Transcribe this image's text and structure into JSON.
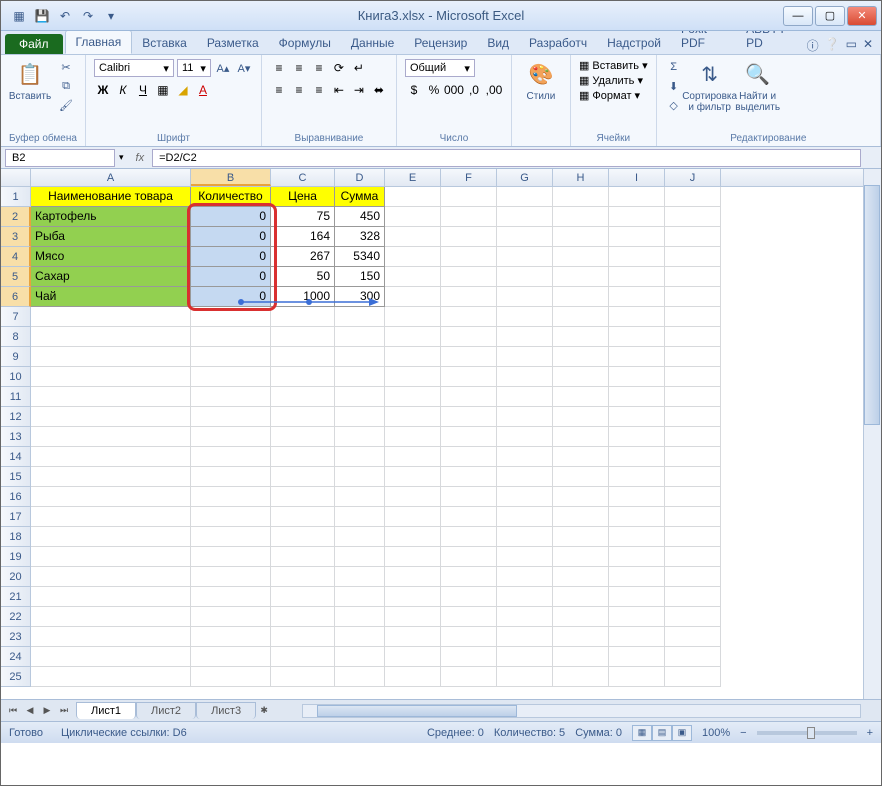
{
  "title": "Книга3.xlsx  -  Microsoft Excel",
  "qat": {
    "save": "💾",
    "undo": "↶",
    "redo": "↷"
  },
  "tabs": {
    "file": "Файл",
    "items": [
      "Главная",
      "Вставка",
      "Разметка",
      "Формулы",
      "Данные",
      "Рецензир",
      "Вид",
      "Разработч",
      "Надстрой",
      "Foxit PDF",
      "ABBYY PD"
    ],
    "active": 0
  },
  "ribbon": {
    "clipboard": {
      "paste": "Вставить",
      "label": "Буфер обмена"
    },
    "font": {
      "name": "Calibri",
      "size": "11",
      "label": "Шрифт"
    },
    "alignment": {
      "label": "Выравнивание"
    },
    "number": {
      "format": "Общий",
      "label": "Число"
    },
    "styles": {
      "btn": "Стили",
      "label": ""
    },
    "cells": {
      "insert": "Вставить",
      "delete": "Удалить",
      "format": "Формат",
      "label": "Ячейки"
    },
    "editing": {
      "sort": "Сортировка и фильтр",
      "find": "Найти и выделить",
      "label": "Редактирование"
    }
  },
  "nameBox": "B2",
  "formula": "=D2/C2",
  "columns": [
    "A",
    "B",
    "C",
    "D",
    "E",
    "F",
    "G",
    "H",
    "I",
    "J"
  ],
  "headers": {
    "A": "Наименование товара",
    "B": "Количество",
    "C": "Цена",
    "D": "Сумма"
  },
  "rows": [
    {
      "n": "1"
    },
    {
      "n": "2",
      "A": "Картофель",
      "B": "0",
      "C": "75",
      "D": "450"
    },
    {
      "n": "3",
      "A": "Рыба",
      "B": "0",
      "C": "164",
      "D": "328"
    },
    {
      "n": "4",
      "A": "Мясо",
      "B": "0",
      "C": "267",
      "D": "5340"
    },
    {
      "n": "5",
      "A": "Сахар",
      "B": "0",
      "C": "50",
      "D": "150"
    },
    {
      "n": "6",
      "A": "Чай",
      "B": "0",
      "C": "1000",
      "D": "300"
    }
  ],
  "emptyRows": [
    "7",
    "8",
    "9",
    "10",
    "11",
    "12",
    "13",
    "14",
    "15",
    "16",
    "17",
    "18",
    "19",
    "20",
    "21",
    "22",
    "23",
    "24",
    "25"
  ],
  "sheets": [
    "Лист1",
    "Лист2",
    "Лист3"
  ],
  "status": {
    "ready": "Готово",
    "circular": "Циклические ссылки: D6",
    "avg": "Среднее: 0",
    "count": "Количество: 5",
    "sum": "Сумма: 0",
    "zoom": "100%"
  }
}
